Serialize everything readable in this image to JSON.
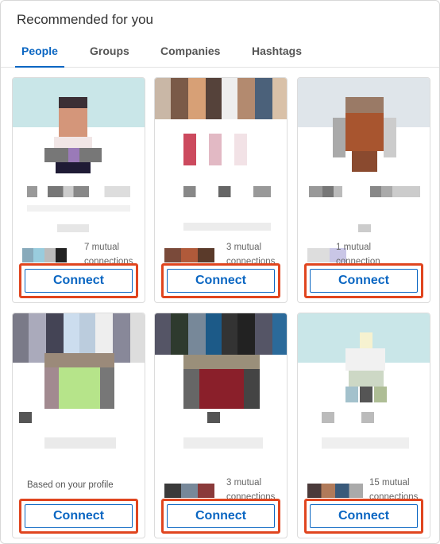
{
  "header": {
    "title": "Recommended for you"
  },
  "tabs": [
    {
      "label": "People",
      "active": true
    },
    {
      "label": "Groups",
      "active": false
    },
    {
      "label": "Companies",
      "active": false
    },
    {
      "label": "Hashtags",
      "active": false
    }
  ],
  "cards": [
    {
      "mutual_text": "7 mutual connections",
      "connect_label": "Connect"
    },
    {
      "mutual_text": "3 mutual connections",
      "connect_label": "Connect"
    },
    {
      "mutual_text": "1 mutual connection",
      "connect_label": "Connect"
    },
    {
      "insight_text": "Based on your profile",
      "connect_label": "Connect"
    },
    {
      "mutual_text": "3 mutual connections",
      "connect_label": "Connect"
    },
    {
      "mutual_text": "15 mutual connections",
      "connect_label": "Connect"
    }
  ],
  "colors": {
    "accent": "#0a66c2",
    "highlight": "#e0451f"
  }
}
